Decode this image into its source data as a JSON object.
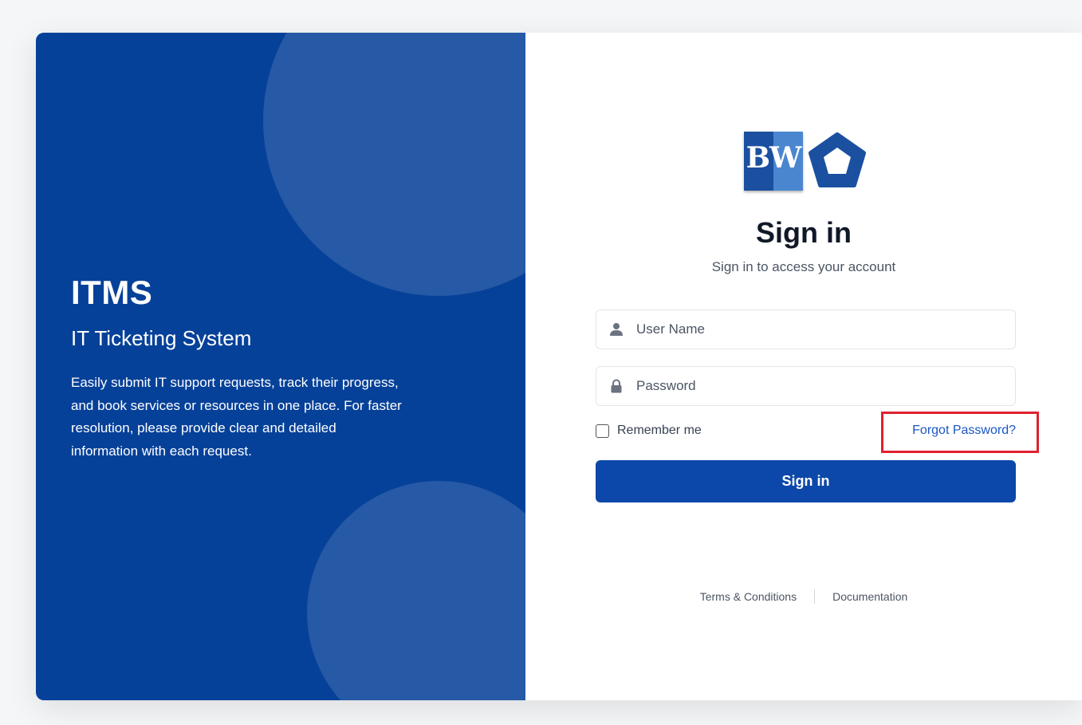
{
  "brand": {
    "title": "ITMS",
    "subtitle": "IT Ticketing System",
    "description": "Easily submit IT support requests, track their progress, and book services or resources in one place. For faster resolution, please provide clear and detailed information with each request."
  },
  "logo": {
    "text": "BW",
    "icon": "pentagon-ring-icon"
  },
  "login": {
    "title": "Sign in",
    "subtitle": "Sign in to access your account",
    "username": {
      "placeholder": "User Name",
      "value": "",
      "icon": "user-icon"
    },
    "password": {
      "placeholder": "Password",
      "value": "",
      "icon": "lock-icon"
    },
    "remember_label": "Remember me",
    "remember_checked": false,
    "forgot_label": "Forgot Password?",
    "submit_label": "Sign in"
  },
  "footer": {
    "terms_label": "Terms & Conditions",
    "docs_label": "Documentation"
  },
  "colors": {
    "panel": "#064199",
    "primary": "#0c48a9",
    "link": "#1a56c4",
    "highlight": "#e0202f"
  }
}
